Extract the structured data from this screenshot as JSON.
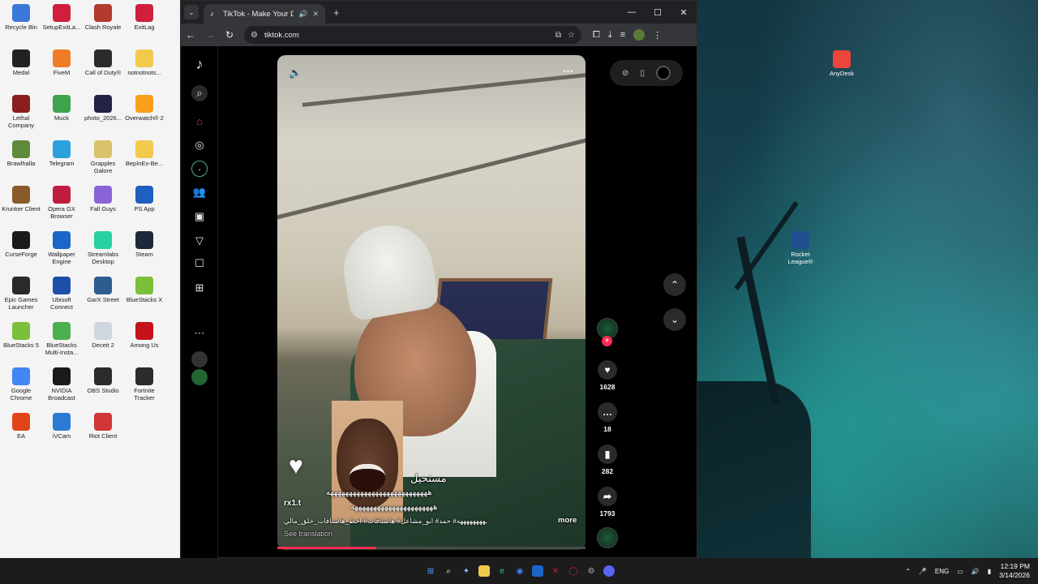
{
  "desktop": {
    "icons_left": [
      {
        "label": "Recycle Bin",
        "icon": "recycle-bin-icon",
        "color": "#3b78d8"
      },
      {
        "label": "SetupExitLa...",
        "icon": "exitlag-icon",
        "color": "#d01f3c"
      },
      {
        "label": "Clash Royale",
        "icon": "clash-royale-icon",
        "color": "#b23a2f"
      },
      {
        "label": "ExitLag",
        "icon": "exitlag-icon",
        "color": "#d01f3c"
      },
      {
        "label": "Medal",
        "icon": "medal-icon",
        "color": "#222222"
      },
      {
        "label": "FiveM",
        "icon": "fivem-icon",
        "color": "#f07c28"
      },
      {
        "label": "Call of Duty®",
        "icon": "call-of-duty-icon",
        "color": "#2b2b2b"
      },
      {
        "label": "notnotnots...",
        "icon": "folder-icon",
        "color": "#f2c94c"
      },
      {
        "label": "Lethal Company",
        "icon": "lethal-company-icon",
        "color": "#8a1e1e"
      },
      {
        "label": "Muck",
        "icon": "muck-icon",
        "color": "#3fa34d"
      },
      {
        "label": "photo_2026...",
        "icon": "photo-icon",
        "color": "#222244"
      },
      {
        "label": "Overwatch® 2",
        "icon": "overwatch-icon",
        "color": "#f99e1a"
      },
      {
        "label": "Brawlhalla",
        "icon": "brawlhalla-icon",
        "color": "#5f8a3a"
      },
      {
        "label": "Telegram",
        "icon": "telegram-icon",
        "color": "#2aa1da"
      },
      {
        "label": "Grapples Galore",
        "icon": "grapples-galore-icon",
        "color": "#d9c26a"
      },
      {
        "label": "BepInEx-Be...",
        "icon": "folder-icon",
        "color": "#f2c94c"
      },
      {
        "label": "Krunker Client",
        "icon": "krunker-icon",
        "color": "#8a5a2b"
      },
      {
        "label": "Opera GX Browser",
        "icon": "opera-gx-icon",
        "color": "#c01c3f"
      },
      {
        "label": "Fall Guys",
        "icon": "fall-guys-icon",
        "color": "#8a64d6"
      },
      {
        "label": "PS App",
        "icon": "ps-app-icon",
        "color": "#1f5fbf"
      },
      {
        "label": "CurseForge",
        "icon": "curseforge-icon",
        "color": "#1a1a1a"
      },
      {
        "label": "Wallpaper Engine",
        "icon": "wallpaper-engine-icon",
        "color": "#1b66c9"
      },
      {
        "label": "Streamlabs Desktop",
        "icon": "streamlabs-icon",
        "color": "#2ad1a0"
      },
      {
        "label": "Steam",
        "icon": "steam-icon",
        "color": "#1b2838"
      },
      {
        "label": "Epic Games Launcher",
        "icon": "epic-games-icon",
        "color": "#2a2a2a"
      },
      {
        "label": "Ubisoft Connect",
        "icon": "ubisoft-icon",
        "color": "#1e4fa8"
      },
      {
        "label": "GarX Street",
        "icon": "game-icon",
        "color": "#2d5d8f"
      },
      {
        "label": "BlueStacks X",
        "icon": "bluestacks-icon",
        "color": "#7bbf3a"
      },
      {
        "label": "BlueStacks 5",
        "icon": "bluestacks-icon",
        "color": "#7bbf3a"
      },
      {
        "label": "BlueStacks Multi-Insta...",
        "icon": "bluestacks-icon",
        "color": "#4caf50"
      },
      {
        "label": "Deceit 2",
        "icon": "deceit-icon",
        "color": "#cfd6dd"
      },
      {
        "label": "Among Us",
        "icon": "among-us-icon",
        "color": "#c5111a"
      },
      {
        "label": "Google Chrome",
        "icon": "chrome-icon",
        "color": "#4285f4"
      },
      {
        "label": "NVIDIA Broadcast",
        "icon": "nvidia-icon",
        "color": "#1a1a1a"
      },
      {
        "label": "OBS Studio",
        "icon": "obs-icon",
        "color": "#2b2b2b"
      },
      {
        "label": "Fortnite Tracker",
        "icon": "fortnite-tracker-icon",
        "color": "#2b2b2b"
      },
      {
        "label": "EA",
        "icon": "ea-icon",
        "color": "#e04418"
      },
      {
        "label": "iVCam",
        "icon": "ivcam-icon",
        "color": "#2b7bd6"
      },
      {
        "label": "Riot Client",
        "icon": "riot-icon",
        "color": "#d13639"
      }
    ],
    "icons_right": [
      {
        "label": "AnyDesk",
        "icon": "anydesk-icon",
        "color": "#ef443b"
      },
      {
        "label": "Rocket League®",
        "icon": "rocket-league-icon",
        "color": "#1f4f8f"
      }
    ]
  },
  "browser": {
    "tab_title": "TikTok - Make Your Day",
    "url": "tiktok.com",
    "controls": {
      "minimize": "—",
      "maximize": "☐",
      "close": "✕"
    }
  },
  "tiktok": {
    "video": {
      "username": "rx1.t",
      "overlay_arabic": "مستحيل",
      "overlay_laugh_1": "هههههههههههههههههههههههههههه",
      "overlay_laugh_2": "ههههههههههههههههههههههه",
      "caption": "ههههههههههههه# حمد# ابو_مشاعل# هاشتاقات# احط_هاشتاقات_خلق_مالي ...",
      "more": "more",
      "see_translation": "See translation",
      "progress": 0.32
    },
    "actions": {
      "likes": "1628",
      "comments": "18",
      "saves": "282",
      "shares": "1793"
    },
    "accent": "#fe2c55"
  },
  "taskbar": {
    "lang": "ENG",
    "time": "12:19 PM",
    "date": "3/14/2026"
  }
}
